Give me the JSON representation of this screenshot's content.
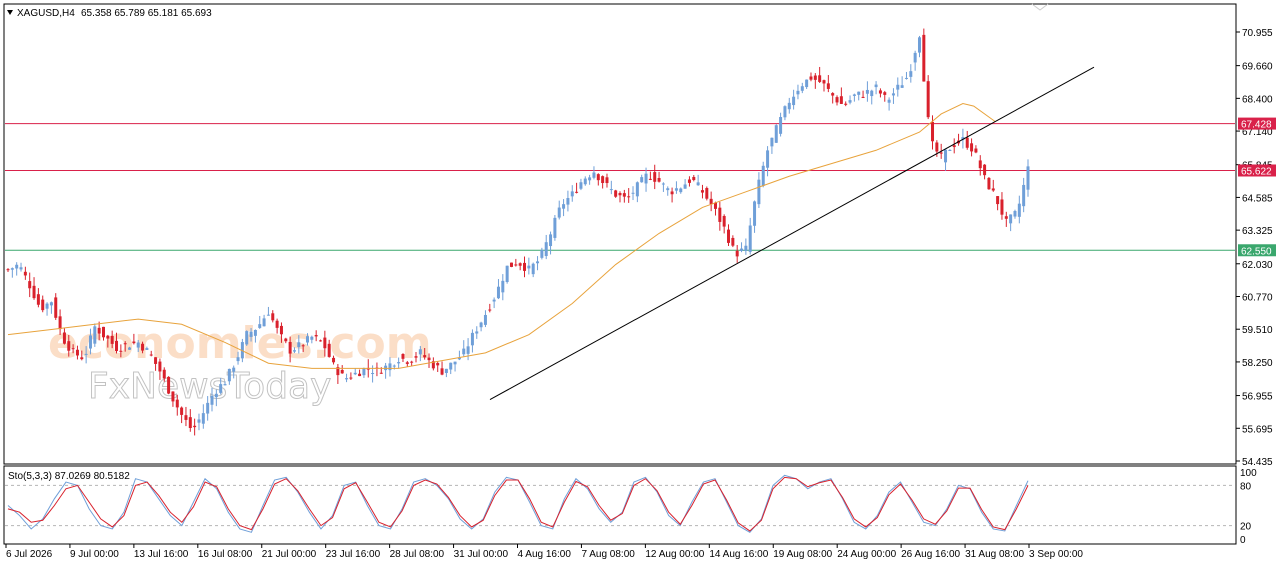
{
  "header": {
    "symbol_label": "XAGUSD,H4",
    "ohlc_label": "65.358 65.789 65.181 65.693"
  },
  "indicator": {
    "label": "Sto(5,3,3) 87.0269 80.5182",
    "levels": [
      "100",
      "80",
      "20",
      "0"
    ]
  },
  "watermark": {
    "line1": "economies.com",
    "line2": "FxNewsToday"
  },
  "colors": {
    "bull": "#6f9fd8",
    "bear": "#d9212c",
    "ma": "#e8a33c",
    "resistance": "#d9214a",
    "support": "#3aa76d",
    "trendline": "#000000",
    "stoch_main": "#6f9fd8",
    "stoch_signal": "#d9212c"
  },
  "chart_data": {
    "type": "candlestick",
    "symbol": "XAGUSD",
    "timeframe": "H4",
    "y_ticks": [
      "70.955",
      "69.660",
      "68.400",
      "67.140",
      "65.845",
      "64.585",
      "63.325",
      "62.030",
      "60.770",
      "59.510",
      "58.250",
      "56.955",
      "55.695",
      "54.435"
    ],
    "ylim": [
      54.435,
      71.3
    ],
    "x_labels": [
      "6 Jul 2026",
      "9 Jul 00:00",
      "13 Jul 16:00",
      "16 Jul 08:00",
      "21 Jul 00:00",
      "23 Jul 16:00",
      "28 Jul 08:00",
      "31 Jul 00:00",
      "4 Aug 16:00",
      "7 Aug 08:00",
      "12 Aug 00:00",
      "14 Aug 16:00",
      "19 Aug 08:00",
      "24 Aug 00:00",
      "26 Aug 16:00",
      "31 Aug 08:00",
      "3 Sep 00:00"
    ],
    "price_tags": [
      {
        "label": "67.428",
        "value": 67.428,
        "kind": "resistance"
      },
      {
        "label": "65.622",
        "value": 65.622,
        "kind": "resistance"
      },
      {
        "label": "62.550",
        "value": 62.55,
        "kind": "support"
      }
    ],
    "close_path": [
      [
        0,
        61.8
      ],
      [
        5,
        62.0
      ],
      [
        10,
        61.2
      ],
      [
        15,
        60.3
      ],
      [
        20,
        60.6
      ],
      [
        25,
        59.2
      ],
      [
        30,
        58.6
      ],
      [
        35,
        58.4
      ],
      [
        40,
        59.6
      ],
      [
        45,
        59.2
      ],
      [
        50,
        58.8
      ],
      [
        55,
        58.9
      ],
      [
        60,
        59.0
      ],
      [
        65,
        58.6
      ],
      [
        70,
        57.9
      ],
      [
        75,
        57.0
      ],
      [
        80,
        56.2
      ],
      [
        85,
        55.6
      ],
      [
        90,
        56.3
      ],
      [
        95,
        57.1
      ],
      [
        100,
        57.5
      ],
      [
        105,
        58.3
      ],
      [
        110,
        59.3
      ],
      [
        115,
        59.6
      ],
      [
        120,
        60.2
      ],
      [
        125,
        59.3
      ],
      [
        130,
        58.7
      ],
      [
        135,
        58.9
      ],
      [
        140,
        59.2
      ],
      [
        145,
        59.0
      ],
      [
        150,
        58.1
      ],
      [
        155,
        57.6
      ],
      [
        160,
        57.8
      ],
      [
        165,
        58.0
      ],
      [
        170,
        57.9
      ],
      [
        175,
        58.1
      ],
      [
        180,
        58.4
      ],
      [
        185,
        58.3
      ],
      [
        190,
        58.6
      ],
      [
        195,
        58.2
      ],
      [
        200,
        57.9
      ],
      [
        205,
        58.2
      ],
      [
        210,
        58.6
      ],
      [
        215,
        59.4
      ],
      [
        220,
        60.1
      ],
      [
        225,
        60.9
      ],
      [
        230,
        61.9
      ],
      [
        235,
        62.1
      ],
      [
        240,
        61.8
      ],
      [
        245,
        62.2
      ],
      [
        250,
        63.2
      ],
      [
        255,
        64.3
      ],
      [
        260,
        64.7
      ],
      [
        265,
        65.3
      ],
      [
        270,
        65.6
      ],
      [
        275,
        65.1
      ],
      [
        280,
        64.7
      ],
      [
        285,
        64.5
      ],
      [
        290,
        65.0
      ],
      [
        295,
        65.5
      ],
      [
        300,
        65.2
      ],
      [
        305,
        64.8
      ],
      [
        310,
        65.0
      ],
      [
        315,
        65.3
      ],
      [
        320,
        64.8
      ],
      [
        325,
        64.2
      ],
      [
        330,
        63.4
      ],
      [
        335,
        62.4
      ],
      [
        340,
        62.6
      ],
      [
        345,
        64.8
      ],
      [
        350,
        66.4
      ],
      [
        355,
        67.4
      ],
      [
        360,
        68.3
      ],
      [
        365,
        68.9
      ],
      [
        370,
        69.2
      ],
      [
        375,
        69.0
      ],
      [
        380,
        68.5
      ],
      [
        385,
        68.1
      ],
      [
        390,
        68.5
      ],
      [
        395,
        68.6
      ],
      [
        400,
        68.8
      ],
      [
        405,
        68.3
      ],
      [
        410,
        68.8
      ],
      [
        415,
        69.3
      ],
      [
        420,
        70.9
      ],
      [
        425,
        66.7
      ],
      [
        430,
        66.1
      ],
      [
        435,
        66.6
      ],
      [
        440,
        66.8
      ],
      [
        445,
        66.4
      ],
      [
        450,
        65.3
      ],
      [
        455,
        64.6
      ],
      [
        460,
        63.6
      ],
      [
        465,
        64.0
      ],
      [
        470,
        65.7
      ]
    ],
    "ma_path": [
      [
        0,
        59.3
      ],
      [
        20,
        59.5
      ],
      [
        40,
        59.7
      ],
      [
        60,
        59.9
      ],
      [
        80,
        59.7
      ],
      [
        100,
        59.0
      ],
      [
        120,
        58.2
      ],
      [
        140,
        58.0
      ],
      [
        160,
        58.0
      ],
      [
        180,
        58.0
      ],
      [
        200,
        58.3
      ],
      [
        220,
        58.6
      ],
      [
        240,
        59.3
      ],
      [
        260,
        60.5
      ],
      [
        280,
        62.0
      ],
      [
        300,
        63.2
      ],
      [
        320,
        64.2
      ],
      [
        340,
        64.8
      ],
      [
        360,
        65.4
      ],
      [
        380,
        65.9
      ],
      [
        400,
        66.4
      ],
      [
        420,
        67.1
      ],
      [
        430,
        67.8
      ],
      [
        440,
        68.2
      ],
      [
        445,
        68.1
      ],
      [
        455,
        67.5
      ]
    ],
    "trendline": [
      [
        222,
        56.8
      ],
      [
        495,
        69.6
      ]
    ],
    "stochastic": {
      "main": [
        50,
        35,
        15,
        30,
        60,
        85,
        80,
        45,
        20,
        15,
        40,
        90,
        85,
        60,
        35,
        20,
        55,
        90,
        75,
        40,
        15,
        10,
        50,
        88,
        92,
        70,
        40,
        15,
        35,
        80,
        85,
        50,
        20,
        15,
        45,
        85,
        90,
        80,
        60,
        30,
        15,
        30,
        70,
        92,
        88,
        55,
        20,
        15,
        60,
        90,
        75,
        45,
        25,
        40,
        85,
        92,
        70,
        35,
        20,
        55,
        85,
        90,
        55,
        20,
        10,
        30,
        80,
        95,
        90,
        75,
        85,
        90,
        60,
        25,
        15,
        35,
        70,
        85,
        55,
        25,
        20,
        45,
        80,
        75,
        40,
        15,
        12,
        50,
        87
      ],
      "signal": [
        45,
        40,
        25,
        28,
        50,
        75,
        80,
        55,
        30,
        18,
        35,
        80,
        85,
        65,
        40,
        25,
        48,
        85,
        78,
        45,
        20,
        14,
        45,
        82,
        90,
        72,
        45,
        20,
        32,
        75,
        84,
        55,
        25,
        18,
        42,
        80,
        88,
        82,
        62,
        35,
        18,
        28,
        65,
        88,
        88,
        60,
        25,
        18,
        55,
        86,
        78,
        50,
        28,
        38,
        80,
        90,
        72,
        40,
        22,
        50,
        82,
        88,
        58,
        24,
        12,
        28,
        75,
        92,
        90,
        78,
        84,
        88,
        62,
        30,
        18,
        32,
        66,
        82,
        58,
        30,
        22,
        42,
        76,
        76,
        44,
        18,
        14,
        45,
        80
      ]
    }
  }
}
